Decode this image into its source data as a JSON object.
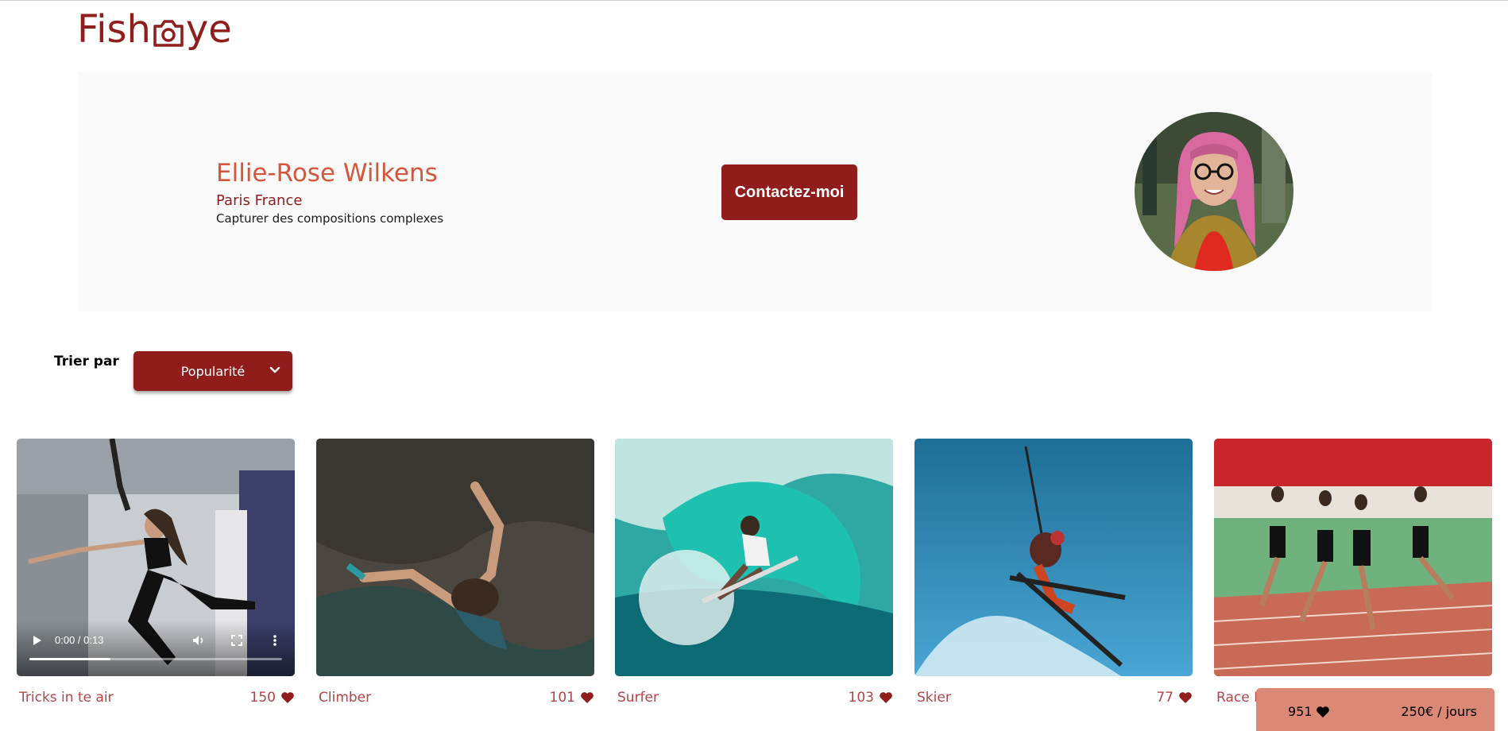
{
  "logo": {
    "text_before": "Fish",
    "text_after": "ye"
  },
  "photographer": {
    "name": "Ellie-Rose Wilkens",
    "location": "Paris France",
    "tagline": "Capturer des compositions complexes",
    "contact_label": "Contactez-moi"
  },
  "sort": {
    "label": "Trier par",
    "selected": "Popularité"
  },
  "gallery": [
    {
      "title": "Tricks in te air",
      "likes": "150",
      "type": "video"
    },
    {
      "title": "Climber",
      "likes": "101",
      "type": "image"
    },
    {
      "title": "Surfer",
      "likes": "103",
      "type": "image"
    },
    {
      "title": "Skier",
      "likes": "77",
      "type": "image"
    },
    {
      "title": "Race End",
      "likes": "",
      "type": "image"
    }
  ],
  "video": {
    "time": "0:00 / 0:13",
    "progress": 0.32
  },
  "footer": {
    "total_likes": "951",
    "price": "250€ / jours"
  },
  "colors": {
    "primary": "#901C1C",
    "secondary": "#D3573C",
    "badge": "#DB8876",
    "background_light": "#FAFAFA"
  },
  "icons": [
    "camera-icon",
    "chevron-down-icon",
    "heart-icon",
    "play-icon",
    "volume-icon",
    "fullscreen-icon",
    "more-vertical-icon"
  ]
}
